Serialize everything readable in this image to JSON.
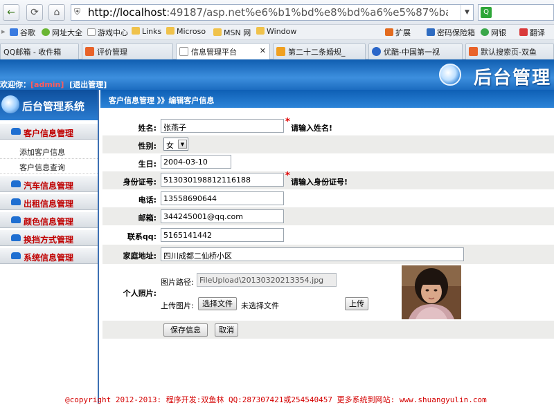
{
  "browser": {
    "url_host": "http://localhost",
    "url_rest": ":49187/asp.net%e6%b1%bd%e8%bd%a6%e5%87%ba%e7%a7%9f",
    "bookmarks": [
      "谷歌",
      "网址大全",
      "游戏中心",
      "Links",
      "Microso",
      "MSN 网",
      "Window"
    ],
    "toolbar_right": [
      "扩展",
      "密码保险箱",
      "网银",
      "翻译"
    ],
    "tabs": [
      {
        "label": "QQ邮箱 - 收件箱",
        "active": false,
        "icon_color": "#4a7fc1"
      },
      {
        "label": "评价管理",
        "active": false,
        "icon_color": "#e8632a"
      },
      {
        "label": "信息管理平台",
        "active": true,
        "icon_color": "#cfcfcf"
      },
      {
        "label": "第二十二条婚规_",
        "active": false,
        "icon_color": "#f0a020"
      },
      {
        "label": "优酷-中国第一视",
        "active": false,
        "icon_color": "#2a66c9"
      },
      {
        "label": "默认搜索页-双鱼",
        "active": false,
        "icon_color": "#e8632a"
      }
    ]
  },
  "header": {
    "welcome_prefix": "欢迎你：",
    "username": "[admin]",
    "logout": "[退出管理]",
    "logo_text": "后台管理"
  },
  "sidebar": {
    "title": "后台管理系统",
    "categories": [
      {
        "label": "客户信息管理",
        "children": [
          "添加客户信息",
          "客户信息查询"
        ]
      },
      {
        "label": "汽车信息管理"
      },
      {
        "label": "出租信息管理"
      },
      {
        "label": "颜色信息管理"
      },
      {
        "label": "换挡方式管理"
      },
      {
        "label": "系统信息管理"
      }
    ]
  },
  "breadcrumb": "客户信息管理 》》编辑客户信息",
  "form": {
    "name_label": "姓名:",
    "name_value": "张燕子",
    "name_hint": "请输入姓名!",
    "gender_label": "性别:",
    "gender_value": "女",
    "birthday_label": "生日:",
    "birthday_value": "2004-03-10",
    "id_label": "身份证号:",
    "id_value": "513030198812116188",
    "id_hint": "请输入身份证号!",
    "phone_label": "电话:",
    "phone_value": "13558690644",
    "email_label": "邮箱:",
    "email_value": "344245001@qq.com",
    "qq_label": "联系qq:",
    "qq_value": "5165141442",
    "address_label": "家庭地址:",
    "address_value": "四川成都二仙桥小区",
    "photo_label": "个人照片:",
    "photo_path_label": "图片路径:",
    "photo_path_value": "FileUpload\\20130320213354.jpg",
    "upload_label": "上传图片:",
    "choose_file": "选择文件",
    "no_file": "未选择文件",
    "upload_button": "上传",
    "save_button": "保存信息",
    "cancel_button": "取消"
  },
  "footer": "@copyright 2012-2013: 程序开发:双鱼林  QQ:287307421或254540457  更多系统到网站: www.shuangyulin.com"
}
